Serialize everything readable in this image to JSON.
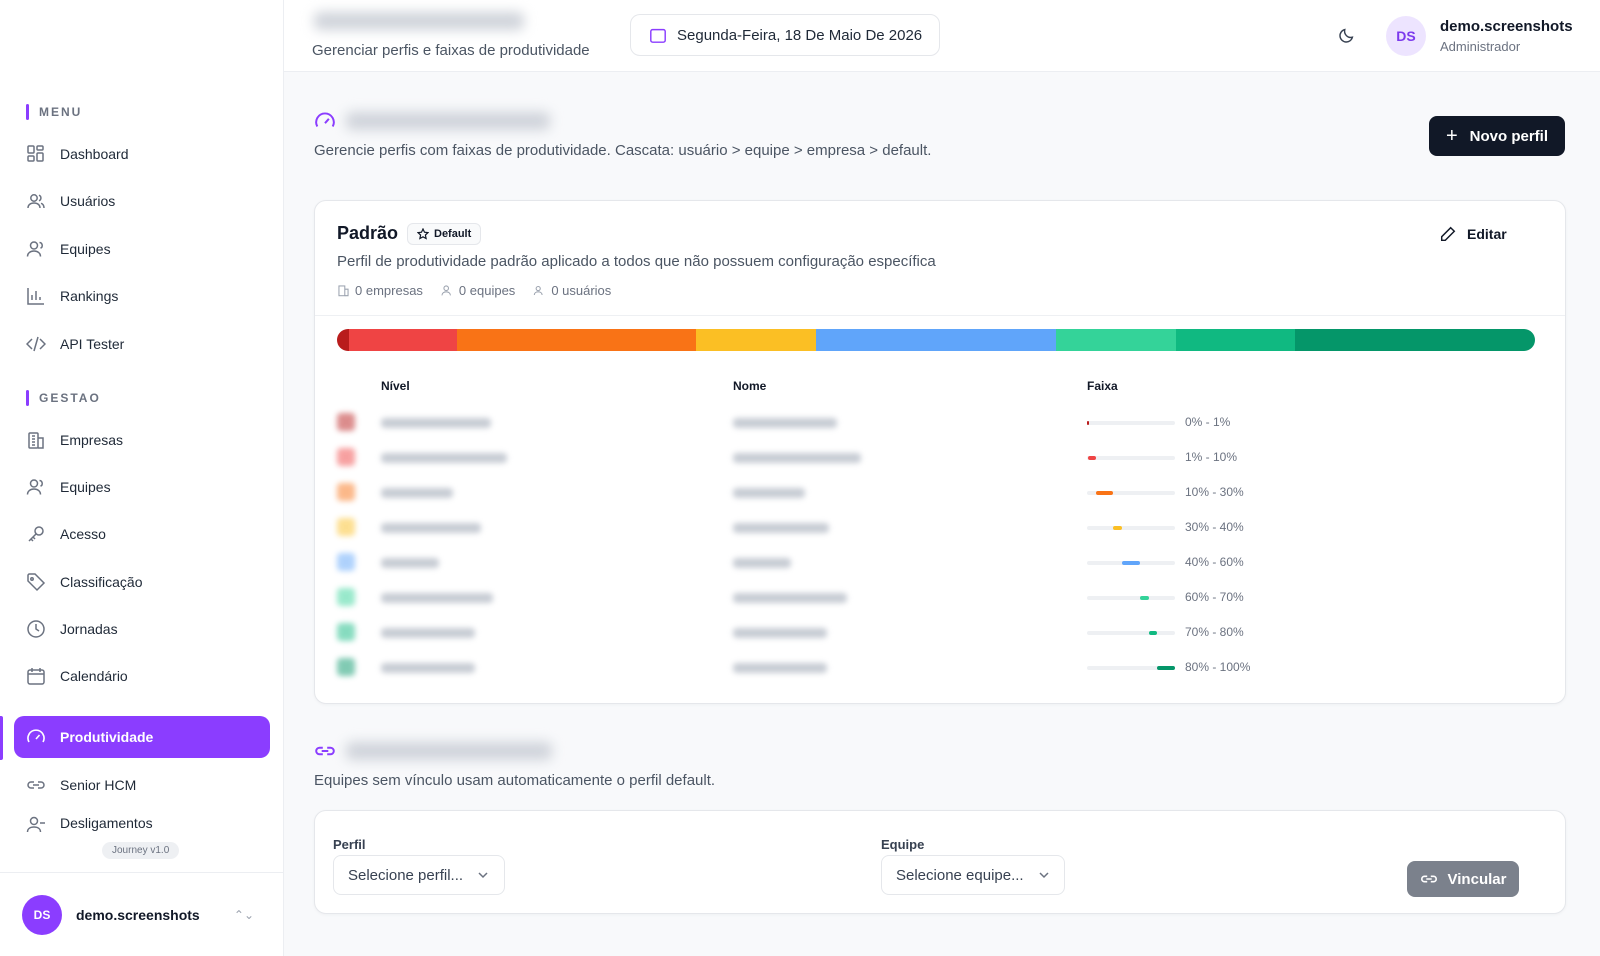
{
  "sidebar": {
    "menu_label": "MENU",
    "gestao_label": "GESTAO",
    "menu_items": [
      {
        "label": "Dashboard",
        "icon": "dashboard-icon"
      },
      {
        "label": "Usuários",
        "icon": "users-icon"
      },
      {
        "label": "Equipes",
        "icon": "team-icon"
      },
      {
        "label": "Rankings",
        "icon": "bar-chart-icon"
      },
      {
        "label": "API Tester",
        "icon": "code-icon"
      }
    ],
    "gestao_items": [
      {
        "label": "Empresas",
        "icon": "building-icon"
      },
      {
        "label": "Equipes",
        "icon": "team-icon"
      },
      {
        "label": "Acesso",
        "icon": "key-icon"
      },
      {
        "label": "Classificação",
        "icon": "tag-icon"
      },
      {
        "label": "Jornadas",
        "icon": "clock-icon"
      },
      {
        "label": "Calendário",
        "icon": "calendar-icon"
      },
      {
        "label": "Produtividade",
        "icon": "gauge-icon",
        "active": true
      },
      {
        "label": "Senior HCM",
        "icon": "link-icon"
      },
      {
        "label": "Desligamentos",
        "icon": "user-minus-icon"
      }
    ],
    "version": "Journey v1.0",
    "footer": {
      "initials": "DS",
      "name": "demo.screenshots"
    }
  },
  "header": {
    "subtitle": "Gerenciar perfis e faixas de produtividade",
    "date": "Segunda-Feira, 18 De Maio De 2026",
    "user": {
      "initials": "DS",
      "name": "demo.screenshots",
      "role": "Administrador"
    }
  },
  "main": {
    "profiles_desc": "Gerencie perfis com faixas de produtividade. Cascata: usuário > equipe > empresa > default.",
    "new_profile_label": "Novo perfil",
    "card": {
      "title": "Padrão",
      "badge": "Default",
      "edit_label": "Editar",
      "description": "Perfil de produtividade padrão aplicado a todos que não possuem configuração específica",
      "stats": {
        "empresas": "0 empresas",
        "equipes": "0 equipes",
        "usuarios": "0 usuários"
      },
      "columns": {
        "nivel": "Nível",
        "nome": "Nome",
        "faixa": "Faixa"
      },
      "levels": [
        {
          "range": "0% - 1%",
          "from": 0,
          "to": 1,
          "color": "#b91c1c"
        },
        {
          "range": "1% - 10%",
          "from": 1,
          "to": 10,
          "color": "#ef4444"
        },
        {
          "range": "10% - 30%",
          "from": 10,
          "to": 30,
          "color": "#f97316"
        },
        {
          "range": "30% - 40%",
          "from": 30,
          "to": 40,
          "color": "#fbbf24"
        },
        {
          "range": "40% - 60%",
          "from": 40,
          "to": 60,
          "color": "#60a5fa"
        },
        {
          "range": "60% - 70%",
          "from": 60,
          "to": 70,
          "color": "#34d399"
        },
        {
          "range": "70% - 80%",
          "from": 70,
          "to": 80,
          "color": "#10b981"
        },
        {
          "range": "80% - 100%",
          "from": 80,
          "to": 100,
          "color": "#059669"
        }
      ]
    },
    "link_desc": "Equipes sem vínculo usam automaticamente o perfil default.",
    "form": {
      "profile_label": "Perfil",
      "profile_placeholder": "Selecione perfil...",
      "team_label": "Equipe",
      "team_placeholder": "Selecione equipe...",
      "link_button": "Vincular"
    }
  },
  "colors": {
    "accent": "#8b3dff",
    "dark": "#111827"
  }
}
